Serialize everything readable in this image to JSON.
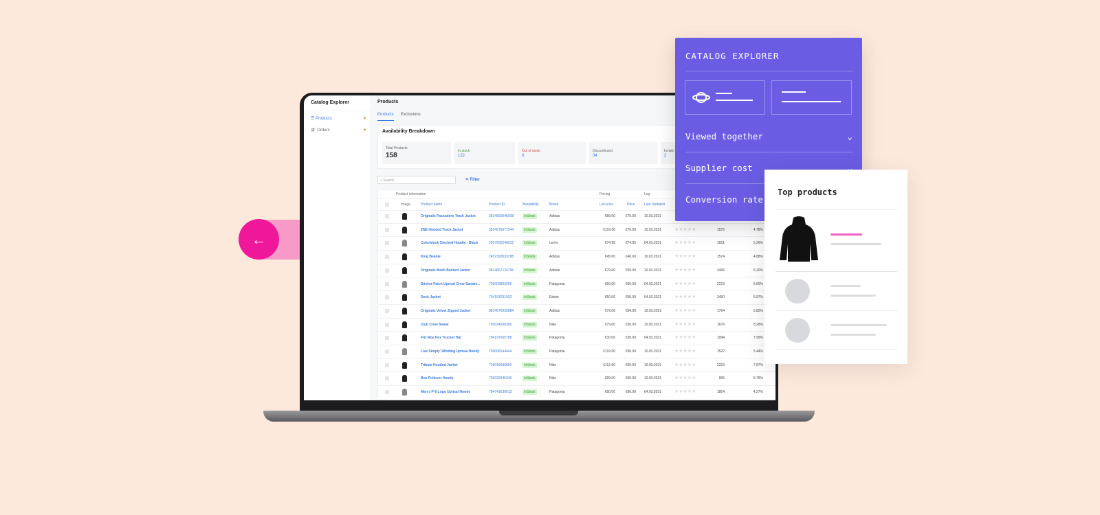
{
  "app": {
    "title": "Catalog Explorer",
    "sidebar": [
      {
        "label": "Products",
        "icon": "list-icon"
      },
      {
        "label": "Orders",
        "icon": "cart-icon"
      }
    ]
  },
  "main": {
    "title": "Products",
    "tabs": [
      "Products",
      "Exclusions"
    ],
    "breakdown": {
      "title": "Availability Breakdown",
      "stats": [
        {
          "label": "Total Products",
          "value": "158"
        },
        {
          "label": "In stock",
          "value": "122"
        },
        {
          "label": "Out of stock",
          "value": "0"
        },
        {
          "label": "Discontinued",
          "value": "34"
        },
        {
          "label": "Invisib",
          "value": "2"
        }
      ]
    },
    "search_placeholder": "Search",
    "filter_label": "Filter",
    "groups": [
      "Product information",
      "Pricing",
      "Log"
    ],
    "columns": [
      "Image",
      "Product name",
      "Product ID",
      "Availability",
      "Brand",
      "List price",
      "Price",
      "Last Updated"
    ],
    "rows": [
      [
        "Originals Passadero Track Jacket",
        "3814660046908",
        "InStock",
        "Adidas",
        "€89.00",
        "€79.00",
        "10.03.2021",
        "",
        ""
      ],
      [
        "ZNE Hooded Track Jacket",
        "3814675677244",
        "InStock",
        "Adidas",
        "€119.00",
        "€76.00",
        "10.03.2021",
        "1575",
        "4.78%"
      ],
      [
        "Colorblock Cinched Hoodie - Black",
        "2507605246012",
        "InStock",
        "Levi's",
        "€74.95",
        "€74.95",
        "04.03.2021",
        "1651",
        "5.26%"
      ],
      [
        "King Beanie",
        "2452393033788",
        "InStock",
        "Adidas",
        "€45.00",
        "€40.00",
        "10.03.2021",
        "1574",
        "4.88%"
      ],
      [
        "Originals Mesh Backed Jacket",
        "3814667124796",
        "InStock",
        "Adidas",
        "€79.00",
        "€59.00",
        "10.03.2021",
        "3496",
        "5.20%"
      ],
      [
        "Sticker Patch Uprisal Crew Sweats...",
        "793002803260",
        "InStock",
        "Patagonia",
        "€60.00",
        "€60.00",
        "04.03.2021",
        "2223",
        "5.60%"
      ],
      [
        "Deck Jacket",
        "794193231932",
        "InStock",
        "Edwin",
        "€50.00",
        "€50.00",
        "04.03.2021",
        "3450",
        "5.97%"
      ],
      [
        "Originals Velvet Zipped Jacket",
        "3814670925884",
        "InStock",
        "Adidas",
        "€79.00",
        "€64.00",
        "10.03.2021",
        "1764",
        "5.82%"
      ],
      [
        "Club Crew Sweat",
        "793024266300",
        "InStock",
        "Nike",
        "€79.00",
        "€50.00",
        "10.03.2021",
        "1676",
        "8.28%"
      ],
      [
        "Fitz Roy Hex Trucker Hat",
        "794197065788",
        "InStock",
        "Patagonia",
        "€30.00",
        "€30.00",
        "04.03.2021",
        "1994",
        "7.99%"
      ],
      [
        "Live Simply' Winding Uprisal Hoody",
        "793008144444",
        "InStock",
        "Patagonia",
        "€119.00",
        "€90.00",
        "10.03.2021",
        "1522",
        "5.44%"
      ],
      [
        "Tribute Hooded Jacket",
        "793016696892",
        "InStock",
        "Nike",
        "€112.00",
        "€50.00",
        "10.03.2021",
        "2223",
        "7.67%"
      ],
      [
        "Box Pullover Hoody",
        "793029345340",
        "InStock",
        "Nike",
        "€99.00",
        "€60.00",
        "10.03.2021",
        "965",
        "6.76%"
      ],
      [
        "Men's P-6 Logo Uprisal Hoody",
        "784741630012",
        "InStock",
        "Patagonia",
        "€90.00",
        "€90.00",
        "04.03.2021",
        "1854",
        "4.27%"
      ]
    ]
  },
  "panel": {
    "title": "CATALOG EXPLORER",
    "items": [
      "Viewed together",
      "Supplier cost",
      "Conversion rate"
    ]
  },
  "card": {
    "title": "Top products"
  },
  "colors": {
    "background": "#fde9dc",
    "panel": "#6a5de3",
    "accent": "#f0189a",
    "link": "#3a78d8"
  }
}
